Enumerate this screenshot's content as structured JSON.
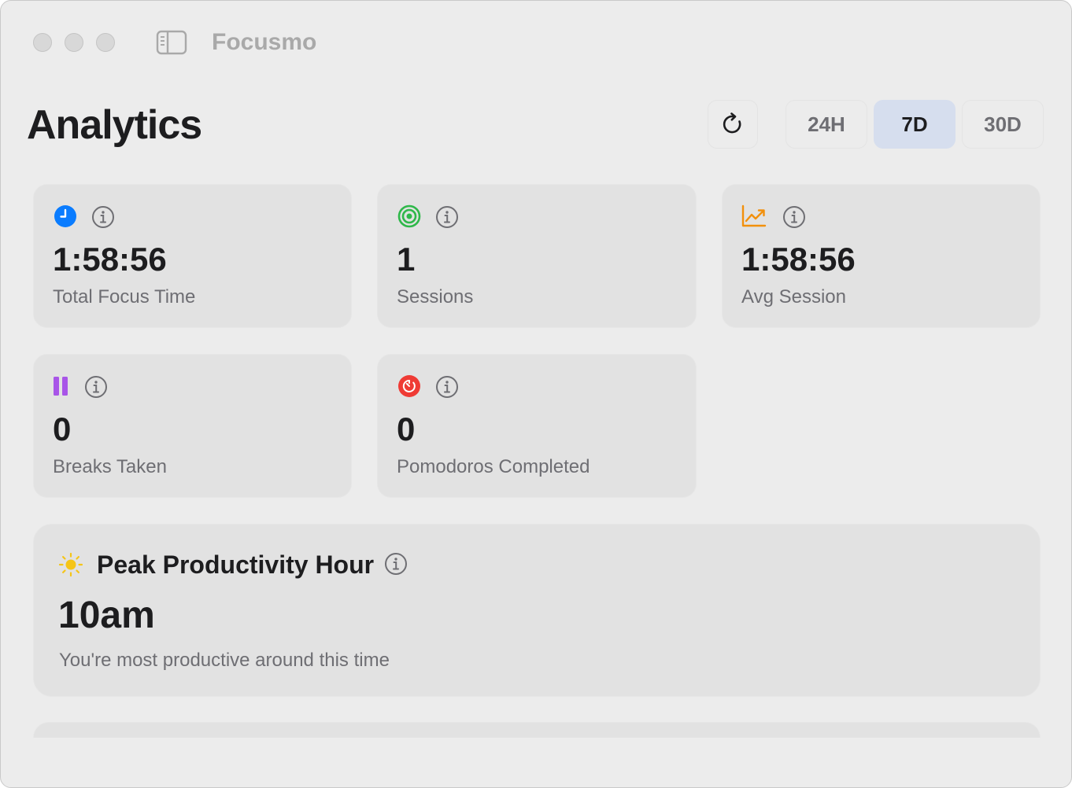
{
  "window": {
    "app_title": "Focusmo",
    "traffic_lights": [
      "close",
      "minimize",
      "zoom"
    ]
  },
  "header": {
    "title": "Analytics",
    "refresh_icon": "refresh-icon",
    "ranges": [
      {
        "label": "24H",
        "selected": false
      },
      {
        "label": "7D",
        "selected": true
      },
      {
        "label": "30D",
        "selected": false
      }
    ],
    "selected_color": "#d6deee"
  },
  "stats": [
    {
      "icon": "clock-icon",
      "icon_color": "#0a7cff",
      "value": "1:58:56",
      "label": "Total Focus Time"
    },
    {
      "icon": "target-icon",
      "icon_color": "#2fb84a",
      "value": "1",
      "label": "Sessions"
    },
    {
      "icon": "chart-line-icon",
      "icon_color": "#f2900c",
      "value": "1:58:56",
      "label": "Avg Session"
    },
    {
      "icon": "pause-icon",
      "icon_color": "#a855e8",
      "value": "0",
      "label": "Breaks Taken"
    },
    {
      "icon": "timer-icon",
      "icon_color": "#ef3b35",
      "value": "0",
      "label": "Pomodoros Completed"
    }
  ],
  "peak": {
    "icon": "sun-icon",
    "icon_color": "#f5c518",
    "title": "Peak Productivity Hour",
    "value": "10am",
    "description": "You're most productive around this time"
  }
}
